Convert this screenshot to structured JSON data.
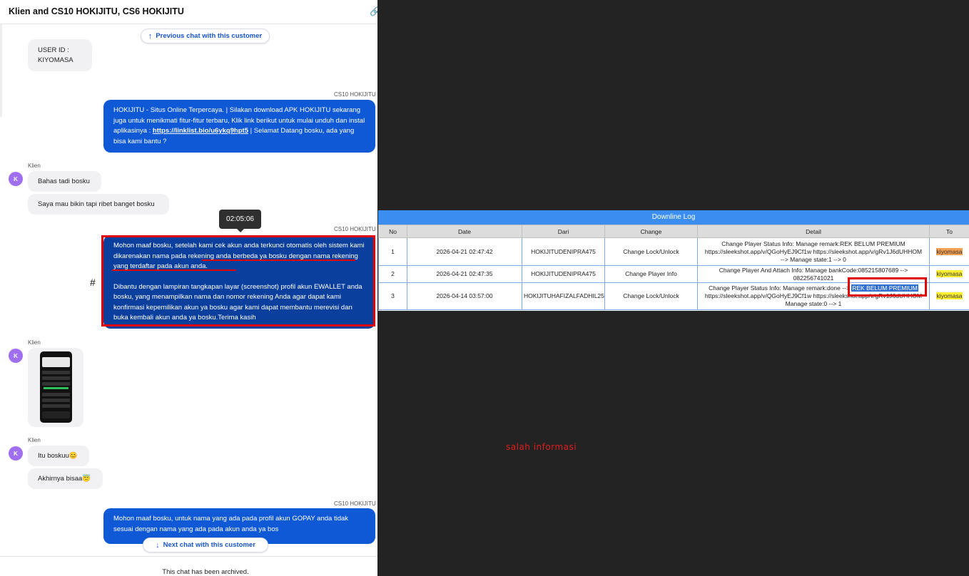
{
  "chat": {
    "title": "Klien and CS10 HOKIJITU, CS6 HOKIJITU",
    "previous_chat": "Previous chat with this customer",
    "next_chat": "Next chat with this customer",
    "archived": "This chat has been archived.",
    "user_id_label": "USER ID :",
    "user_id_value": "KIYOMASA",
    "agent_name": "CS10 HOKIJITU",
    "client_name": "Klien",
    "avatar_letter": "K",
    "msg1_prefix": "HOKIJITU - Situs Online Terpercaya. | Silakan download APK HOKIJITU sekarang juga untuk menikmati fitur-fitur terbaru, Klik link berikut untuk mulai unduh dan instal aplikasinya : ",
    "msg1_link": "https://linklist.bio/u6ykq9hpt5",
    "msg1_suffix": " | Selamat Datang bosku, ada yang bisa kami bantu ?",
    "msg2": "Bahas tadi bosku",
    "msg3": "Saya mau bikin tapi ribet banget bosku",
    "tooltip_time": "02:05:06",
    "msg4_p1": "Mohon maaf bosku, setelah kami cek akun anda terkunci otomatis oleh sistem kami dikarenakan nama pada rekening anda berbeda ya bosku dengan nama rekening yang terdaftar pada akun anda.",
    "msg4_p2": "Dibantu dengan lampiran tangkapan layar (screenshot) profil akun EWALLET anda bosku, yang menampilkan nama dan nomor rekening Anda agar dapat kami konfirmasi kepemilikan akun ya bosku agar kami dapat membantu merevisi dan buka kembali akun anda ya bosku.Terima kasih",
    "hash_mark": "#",
    "msg5": "Itu boskuu😊",
    "msg6": "Akhirnya bisaa😇",
    "msg7": "Mohon maaf bosku, untuk nama yang ada pada profil akun GOPAY anda tidak sesuai dengan nama yang ada pada akun anda ya bos"
  },
  "log": {
    "title": "Downline Log",
    "columns": [
      "No",
      "Date",
      "Dari",
      "Change",
      "Detail",
      "To"
    ],
    "rows": [
      {
        "no": "1",
        "date": "2026-04-21 02:47:42",
        "dari": "HOKIJITUDENIPRA475",
        "change": "Change Lock/Unlock",
        "detail_1": "Change Player Status Info: Manage remark:REK BELUM PREMIUM",
        "detail_2": "https://sleekshot.app/v/QGoHyEJ9Cf1w https://sleekshot.app/v/gRv1J6dUHHOM",
        "detail_3": "--> Manage state:1 --> 0",
        "to": "kiyomasa"
      },
      {
        "no": "2",
        "date": "2026-04-21 02:47:35",
        "dari": "HOKIJITUDENIPRA475",
        "change": "Change Player Info",
        "detail_1": "Change Player And Attach Info: Manage bankCode:085215807689 -->",
        "detail_2": "082256741021",
        "to": "kiyomasa"
      },
      {
        "no": "3",
        "date": "2026-04-14 03:57:00",
        "dari": "HOKIJITUHAFIZALFADHIL25",
        "change": "Change Lock/Unlock",
        "detail_1": "Change Player Status Info: Manage remark:done -->",
        "detail_hl": "REK BELUM PREMIUM",
        "detail_2": "https://sleekshot.app/v/QGoHyEJ9Cf1w https://sleekshot.app/v/gRv1J6dUHHOM",
        "detail_3": "Manage state:0 --> 1",
        "to": "kiyomasa"
      }
    ],
    "annotation": "salah informasi"
  },
  "colors": {
    "agent_bubble": "#0f58d6",
    "client_bubble": "#f1f1f3",
    "avatar": "#a06ff0",
    "annotation_red": "#e00000",
    "log_header": "#3b8ef0",
    "highlight_yellow": "#ffef2e",
    "highlight_orange": "#f5a153"
  }
}
